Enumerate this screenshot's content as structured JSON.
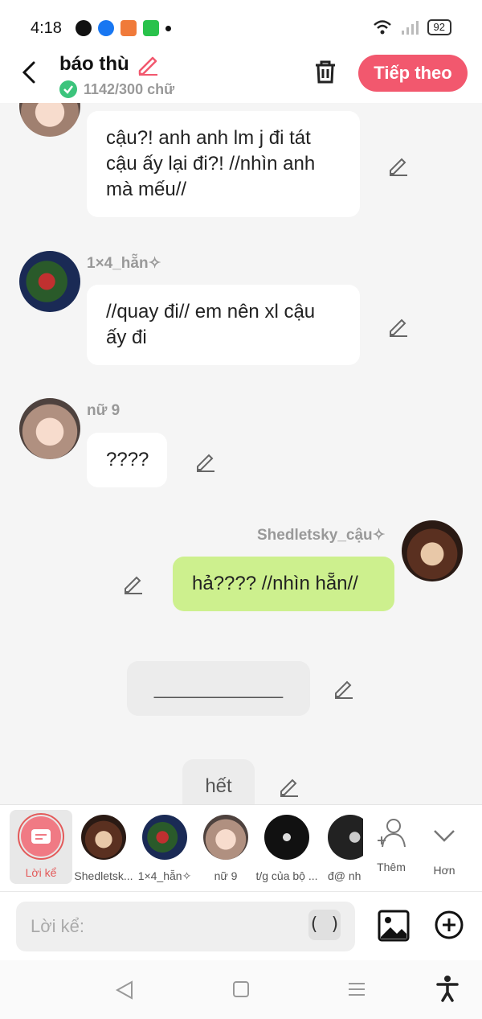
{
  "status": {
    "time": "4:18",
    "battery": "92"
  },
  "header": {
    "title": "báo thù",
    "word_count": "1142/300 chữ",
    "next_label": "Tiếp theo"
  },
  "messages": {
    "m1_text": "cậu?! anh anh lm j đi tát cậu ấy lại đi?! //nhìn anh mà mếu//",
    "m2_name": "1×4_hẵn✧",
    "m2_text": "//quay đi// em nên xl cậu ấy đi",
    "m3_name": "nữ 9",
    "m3_text": "????",
    "m4_name": "Shedletsky_cậu✧",
    "m4_text": "hả???? //nhìn hẵn//",
    "m5_text": "____________",
    "m6_text": "hết"
  },
  "characters": [
    {
      "label": "Lời kể"
    },
    {
      "label": "Shedletsk..."
    },
    {
      "label": "1×4_hẵn✧"
    },
    {
      "label": "nữ 9"
    },
    {
      "label": "t/g của bộ ..."
    },
    {
      "label": "đ@ nh"
    }
  ],
  "actions": {
    "more_label": "Thêm",
    "others_label": "Hơn"
  },
  "input": {
    "placeholder": "Lời kể:",
    "paren": "( )"
  },
  "colors": {
    "accent": "#f2586e",
    "green_bubble": "#cdf08e",
    "check": "#3cc47c"
  }
}
